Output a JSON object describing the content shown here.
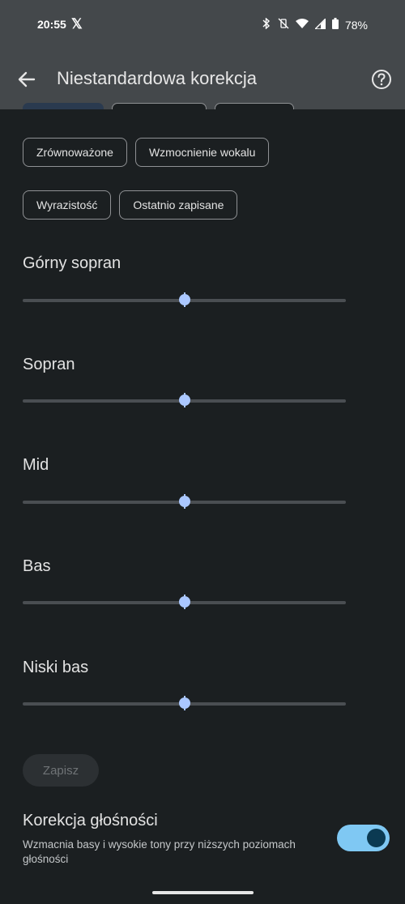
{
  "status_bar": {
    "time": "20:55",
    "battery": "78%"
  },
  "app_bar": {
    "title": "Niestandardowa korekcja"
  },
  "presets": [
    {
      "label": "Zrównoważone"
    },
    {
      "label": "Wzmocnienie wokalu"
    },
    {
      "label": "Wyrazistość"
    },
    {
      "label": "Ostatnio zapisane"
    }
  ],
  "bands": [
    {
      "label": "Górny sopran",
      "value": 0.5
    },
    {
      "label": "Sopran",
      "value": 0.5
    },
    {
      "label": "Mid",
      "value": 0.5
    },
    {
      "label": "Bas",
      "value": 0.5
    },
    {
      "label": "Niski bas",
      "value": 0.5
    }
  ],
  "save_button": {
    "label": "Zapisz",
    "enabled": false
  },
  "loudness": {
    "title": "Korekcja głośności",
    "description": "Wzmacnia basy i wysokie tony przy niższych poziomach głośności",
    "enabled": true
  },
  "colors": {
    "accent": "#aac7ff",
    "toggle_track": "#7fc8f3",
    "background": "#1b1f21",
    "header": "#44484b"
  }
}
